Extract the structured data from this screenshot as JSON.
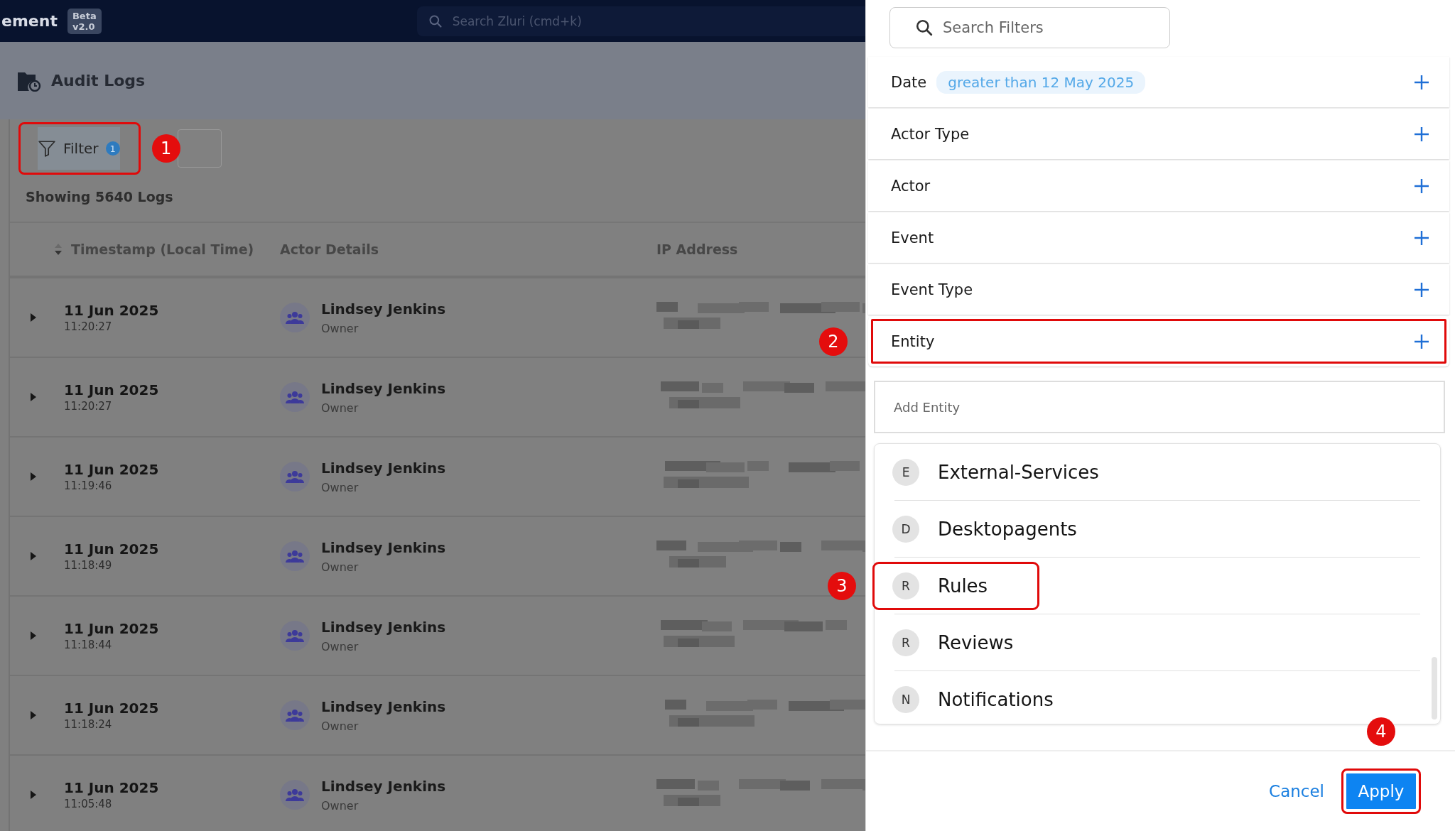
{
  "header": {
    "app_title": "ement",
    "badge": "Beta v2.0",
    "search": {
      "placeholder": "Search Zluri (cmd+k)"
    }
  },
  "page": {
    "title": "Audit Logs",
    "filter_button": {
      "label": "Filter",
      "count": "1",
      "highlighted": true,
      "marker": "1"
    },
    "summary": "Showing 5640 Logs",
    "table": {
      "columns": [
        "Timestamp (Local Time)",
        "Actor Details",
        "IP Address"
      ],
      "rows": [
        {
          "date": "11 Jun 2025",
          "time": "11:20:27",
          "actor": "Lindsey Jenkins",
          "role": "Owner"
        },
        {
          "date": "11 Jun 2025",
          "time": "11:20:27",
          "actor": "Lindsey Jenkins",
          "role": "Owner"
        },
        {
          "date": "11 Jun 2025",
          "time": "11:19:46",
          "actor": "Lindsey Jenkins",
          "role": "Owner"
        },
        {
          "date": "11 Jun 2025",
          "time": "11:18:49",
          "actor": "Lindsey Jenkins",
          "role": "Owner"
        },
        {
          "date": "11 Jun 2025",
          "time": "11:18:44",
          "actor": "Lindsey Jenkins",
          "role": "Owner"
        },
        {
          "date": "11 Jun 2025",
          "time": "11:18:24",
          "actor": "Lindsey Jenkins",
          "role": "Owner"
        },
        {
          "date": "11 Jun 2025",
          "time": "11:05:48",
          "actor": "Lindsey Jenkins",
          "role": "Owner"
        }
      ]
    }
  },
  "filter_panel": {
    "search": {
      "placeholder": "Search Filters"
    },
    "filters": [
      {
        "label": "Date",
        "value": "greater than 12 May 2025",
        "highlighted": false
      },
      {
        "label": "Actor Type",
        "highlighted": false
      },
      {
        "label": "Actor",
        "highlighted": false
      },
      {
        "label": "Event",
        "highlighted": false
      },
      {
        "label": "Event Type",
        "highlighted": false
      },
      {
        "label": "Entity",
        "highlighted": true,
        "marker": "2"
      }
    ],
    "entity_input": {
      "placeholder": "Add Entity"
    },
    "options": [
      {
        "initial": "E",
        "label": "External-Services",
        "highlighted": false
      },
      {
        "initial": "D",
        "label": "Desktopagents",
        "highlighted": false
      },
      {
        "initial": "R",
        "label": "Rules",
        "highlighted": true,
        "marker": "3"
      },
      {
        "initial": "R",
        "label": "Reviews",
        "highlighted": false
      },
      {
        "initial": "N",
        "label": "Notifications",
        "highlighted": false
      }
    ],
    "actions": {
      "cancel": "Cancel",
      "apply": {
        "label": "Apply",
        "highlighted": true,
        "marker": "4"
      }
    }
  }
}
